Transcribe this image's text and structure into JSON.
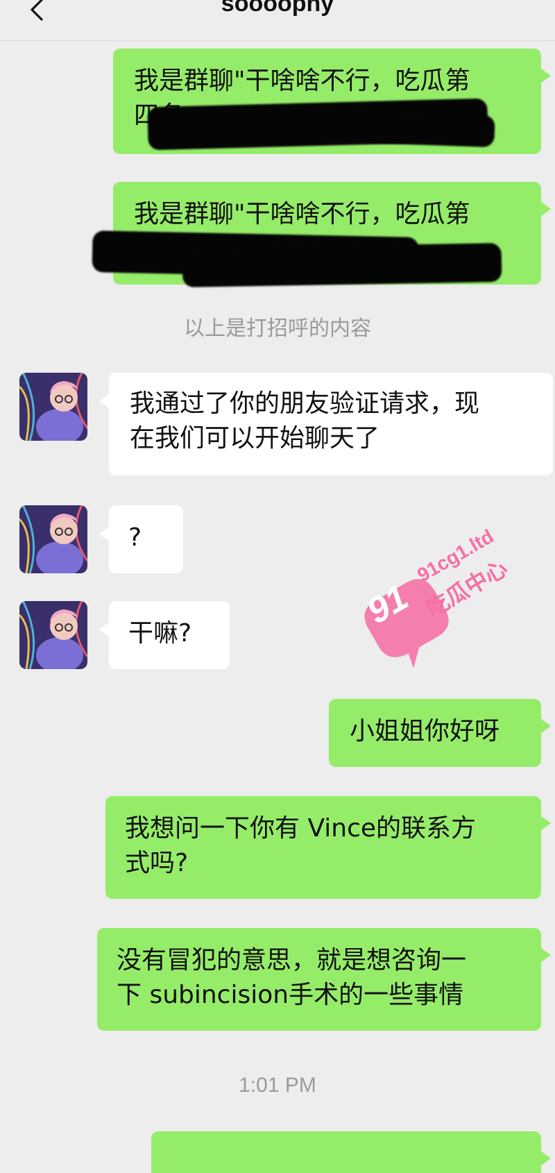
{
  "header": {
    "title": "soooophy",
    "back_icon": "chevron-left-icon"
  },
  "messages": [
    {
      "id": "m1",
      "side": "right",
      "lines": "我是群聊\"干啥啥不行，吃瓜第\n四名",
      "redacted": true
    },
    {
      "id": "m2",
      "side": "right",
      "lines": "我是群聊\"干啥啥不行，吃瓜第",
      "redacted": true
    },
    {
      "id": "m3",
      "side": "left",
      "lines": "我通过了你的朋友验证请求，现\n在我们可以开始聊天了"
    },
    {
      "id": "m4",
      "side": "left",
      "lines": "?"
    },
    {
      "id": "m5",
      "side": "left",
      "lines": "干嘛?"
    },
    {
      "id": "m6",
      "side": "right",
      "lines": "小姐姐你好呀"
    },
    {
      "id": "m7",
      "side": "right",
      "lines": "我想问一下你有 Vince的联系方\n式吗?"
    },
    {
      "id": "m8",
      "side": "right",
      "lines": "没有冒犯的意思，就是想咨询一\n下 subincision手术的一些事情"
    }
  ],
  "notes": {
    "greeting_note": "以上是打招呼的内容",
    "timestamp": "1:01 PM"
  },
  "watermark": {
    "badge": "91",
    "domain": "91cg1.ltd",
    "label": "吃瓜中心"
  },
  "colors": {
    "background": "#ededed",
    "sent_bubble": "#95ec69",
    "received_bubble": "#ffffff",
    "note_text": "#9a9a9a",
    "watermark_pink": "#f56fa6"
  }
}
